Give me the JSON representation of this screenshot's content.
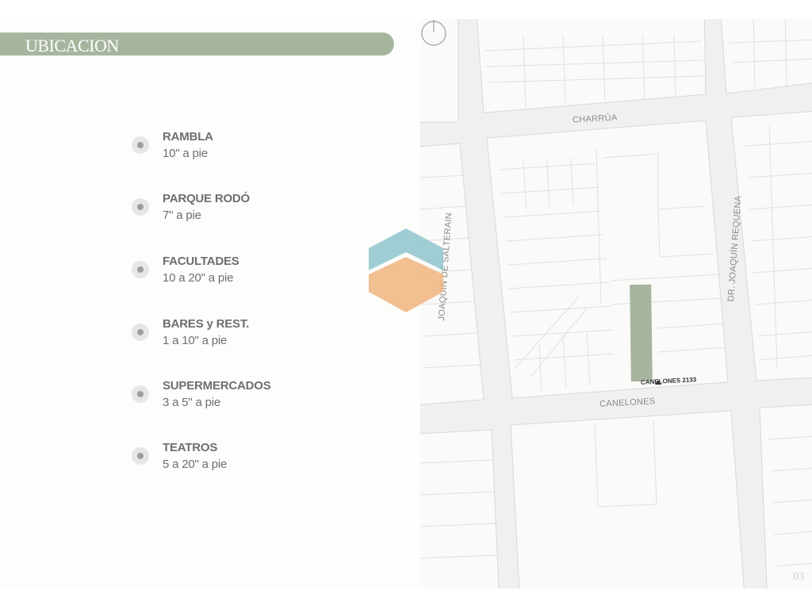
{
  "header": {
    "title": "UBICACION"
  },
  "locations": [
    {
      "name": "RAMBLA",
      "time": "10\" a pie"
    },
    {
      "name": "PARQUE RODÓ",
      "time": "7\" a pie"
    },
    {
      "name": "FACULTADES",
      "time": "10 a 20\" a pie"
    },
    {
      "name": "BARES y REST.",
      "time": "1 a 10\" a pie"
    },
    {
      "name": "SUPERMERCADOS",
      "time": "3 a 5\" a pie"
    },
    {
      "name": "TEATROS",
      "time": "5 a 20\" a pie"
    }
  ],
  "map": {
    "streets": {
      "charrua": "CHARRÚA",
      "salterain": "JOAQUÍN DE SALTERAIN",
      "requena": "DR. JOAQUÍN REQUENA",
      "canelones": "CANELONES"
    },
    "address": "CANELONES 2133",
    "highlight_color": "#a7b59f"
  },
  "page": {
    "number": "03"
  },
  "colors": {
    "accent": "#a7b59f",
    "text": "#6e6e6e",
    "watermark_top": "#8fc4cc",
    "watermark_bottom": "#f0b47e"
  },
  "icons": {
    "bullet": "circle-bullet-icon",
    "power": "power-icon",
    "marker": "triangle-marker-icon"
  }
}
